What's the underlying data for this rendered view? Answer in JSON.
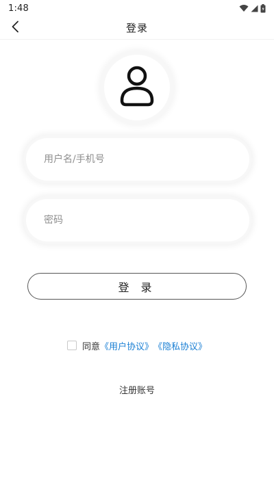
{
  "status_bar": {
    "time": "1:48",
    "icons": [
      "wifi-icon",
      "signal-icon",
      "battery-icon"
    ]
  },
  "header": {
    "title": "登录",
    "back_icon": "chevron-left-icon"
  },
  "avatar": {
    "icon": "user-icon"
  },
  "form": {
    "username": {
      "value": "",
      "placeholder": "用户名/手机号"
    },
    "password": {
      "value": "",
      "placeholder": "密码"
    },
    "login_label": "登 录"
  },
  "agreement": {
    "checked": false,
    "prefix": "同意",
    "user_agreement": "《用户协议》",
    "privacy_policy": "《隐私协议》",
    "link_color": "#1a7fd4"
  },
  "register_label": "注册账号"
}
